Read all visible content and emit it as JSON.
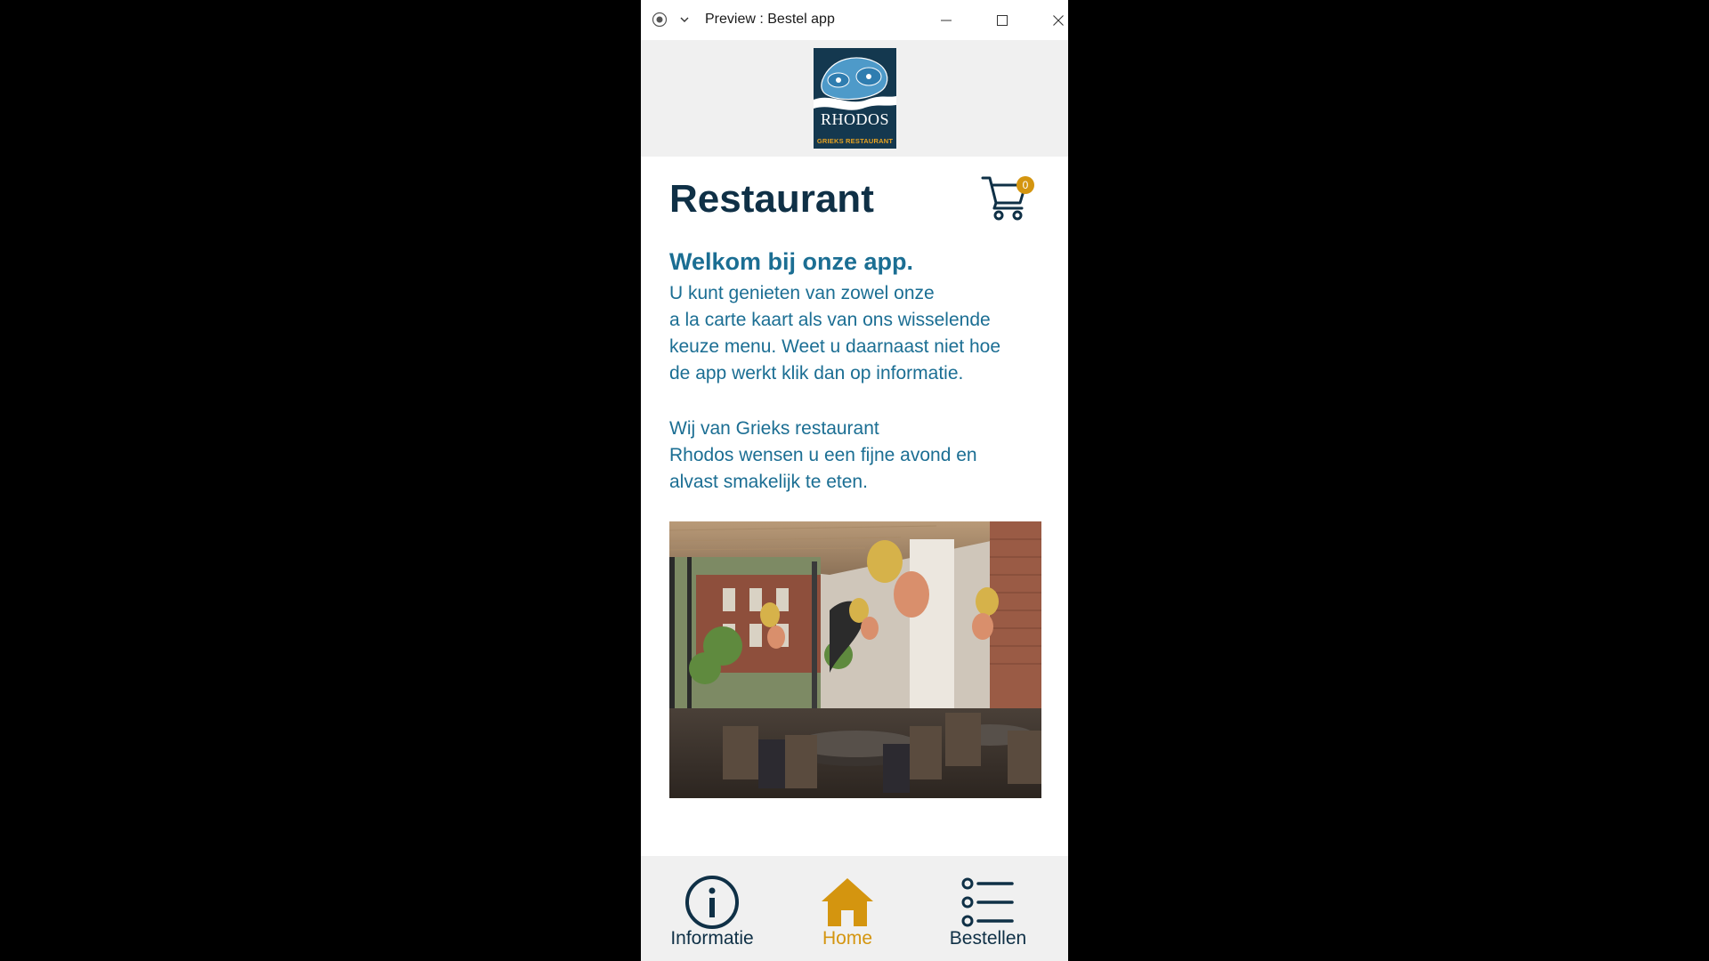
{
  "window": {
    "title": "Preview : Bestel app",
    "controls": [
      "minimize",
      "maximize",
      "close"
    ]
  },
  "logo": {
    "name": "RHODOS",
    "subtitle": "GRIEKS RESTAURANT"
  },
  "page": {
    "title": "Restaurant",
    "cart_count": "0",
    "welcome_heading": "Welkom bij onze app.",
    "paragraph1": [
      "U kunt genieten van zowel onze",
      "a la carte kaart als van ons wisselende",
      "keuze menu. Weet u daarnaast niet hoe",
      "de app werkt klik dan op informatie."
    ],
    "paragraph2": [
      "Wij van Grieks restaurant",
      "Rhodos wensen u een fijne avond en",
      "alvast smakelijk te eten."
    ]
  },
  "nav": {
    "items": [
      {
        "label": "Informatie",
        "icon": "info-icon",
        "active": false
      },
      {
        "label": "Home",
        "icon": "home-icon",
        "active": true
      },
      {
        "label": "Bestellen",
        "icon": "list-icon",
        "active": false
      }
    ]
  },
  "colors": {
    "primary_dark": "#0f3046",
    "text_blue": "#1b6e93",
    "accent": "#d4950f",
    "nav_bg": "#f0f0f0"
  }
}
